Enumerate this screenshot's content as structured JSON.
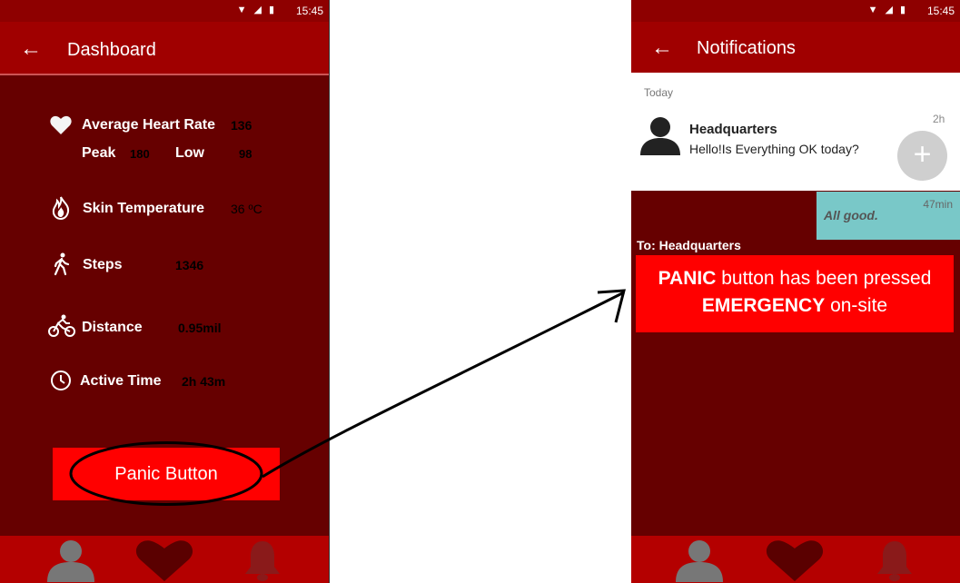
{
  "status": {
    "time": "15:45"
  },
  "dashboard": {
    "title": "Dashboard",
    "heart_rate": {
      "label": "Average Heart Rate",
      "value": "136",
      "peak_label": "Peak",
      "peak_value": "180",
      "low_label": "Low",
      "low_value": "98"
    },
    "skin_temp": {
      "label": "Skin Temperature",
      "value": "36 ºC"
    },
    "steps": {
      "label": "Steps",
      "value": "1346"
    },
    "distance": {
      "label": "Distance",
      "value": "0.95mil"
    },
    "active_time": {
      "label": "Active Time",
      "value": "2h 43m"
    },
    "panic_button": "Panic Button"
  },
  "notifications": {
    "title": "Notifications",
    "section": "Today",
    "message": {
      "sender": "Headquarters",
      "text": "Hello!Is Everything OK today?",
      "time": "2h"
    },
    "reply": {
      "text": "All good.",
      "time": "47min"
    },
    "to_label": "To: Headquarters",
    "alert": {
      "line1_bold": "PANIC",
      "line1_rest": " button has been pressed",
      "line2_bold": "EMERGENCY",
      "line2_rest": " on-site"
    },
    "add_symbol": "+"
  },
  "icons": [
    "wifi-icon",
    "signal-icon",
    "battery-icon",
    "back-arrow-icon",
    "heart-icon",
    "flame-icon",
    "walk-icon",
    "bike-icon",
    "clock-icon",
    "person-icon",
    "bell-icon",
    "plus-icon"
  ],
  "colors": {
    "dark_red": "#660000",
    "app_bar": "#a00000",
    "panic": "#ff0000",
    "reply": "#79c8c8"
  }
}
